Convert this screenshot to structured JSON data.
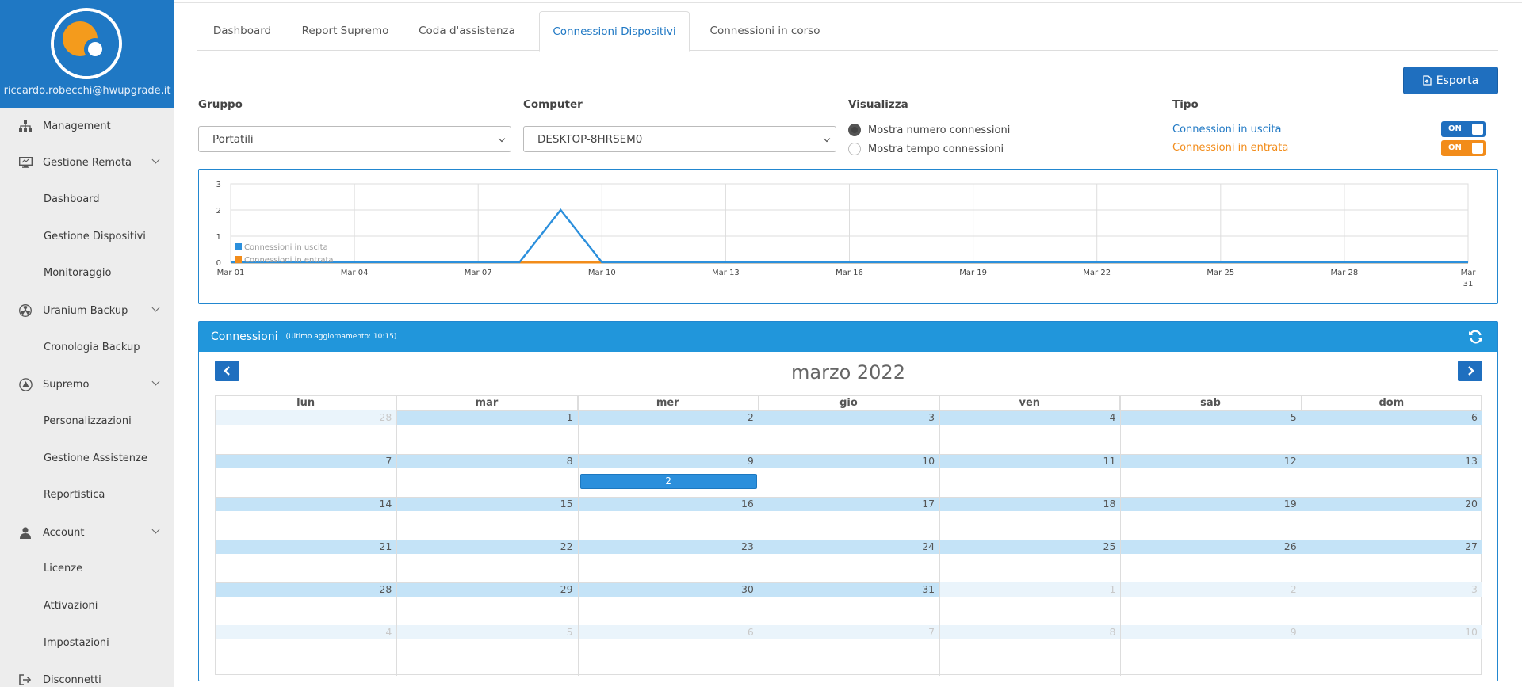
{
  "sidebar": {
    "email": "riccardo.robecchi@hwupgrade.it",
    "items": [
      {
        "label": "Management",
        "icon": "sitemap-icon"
      },
      {
        "label": "Gestione Remota",
        "icon": "desktop-icon"
      },
      {
        "label": "Dashboard"
      },
      {
        "label": "Gestione Dispositivi"
      },
      {
        "label": "Monitoraggio"
      },
      {
        "label": "Uranium Backup",
        "icon": "radiation-icon"
      },
      {
        "label": "Cronologia Backup"
      },
      {
        "label": "Supremo",
        "icon": "supremo-icon"
      },
      {
        "label": "Personalizzazioni"
      },
      {
        "label": "Gestione Assistenze"
      },
      {
        "label": "Reportistica"
      },
      {
        "label": "Account",
        "icon": "user-icon"
      },
      {
        "label": "Licenze"
      },
      {
        "label": "Attivazioni"
      },
      {
        "label": "Impostazioni"
      },
      {
        "label": "Disconnetti",
        "icon": "sign-out-icon"
      }
    ]
  },
  "tabs": [
    "Dashboard",
    "Report Supremo",
    "Coda d'assistenza",
    "Connessioni Dispositivi",
    "Connessioni in corso"
  ],
  "active_tab": "Connessioni Dispositivi",
  "toolbar": {
    "export_label": "Esporta"
  },
  "filters": {
    "gruppo_label": "Gruppo",
    "gruppo_value": "Portatili",
    "computer_label": "Computer",
    "computer_value": "DESKTOP-8HRSEM0",
    "visualizza_label": "Visualizza",
    "radio_count": "Mostra numero connessioni",
    "radio_time": "Mostra tempo connessioni",
    "tipo_label": "Tipo",
    "tipo_out": "Connessioni in uscita",
    "tipo_in": "Connessioni in entrata",
    "toggle_on": "ON"
  },
  "colors": {
    "accent": "#1f78c4",
    "outgoing": "#2b8fdc",
    "incoming": "#f28c1a",
    "day_band": "#c4e3f7"
  },
  "chart_data": {
    "type": "line",
    "x": [
      "Mar 01",
      "Mar 02",
      "Mar 03",
      "Mar 04",
      "Mar 05",
      "Mar 06",
      "Mar 07",
      "Mar 08",
      "Mar 09",
      "Mar 10",
      "Mar 11",
      "Mar 12",
      "Mar 13",
      "Mar 14",
      "Mar 15",
      "Mar 16",
      "Mar 17",
      "Mar 18",
      "Mar 19",
      "Mar 20",
      "Mar 21",
      "Mar 22",
      "Mar 23",
      "Mar 24",
      "Mar 25",
      "Mar 26",
      "Mar 27",
      "Mar 28",
      "Mar 29",
      "Mar 30",
      "Mar 31"
    ],
    "tick_labels": [
      "Mar 01",
      "Mar 04",
      "Mar 07",
      "Mar 10",
      "Mar 13",
      "Mar 16",
      "Mar 19",
      "Mar 22",
      "Mar 25",
      "Mar 28",
      "Mar 31"
    ],
    "series": [
      {
        "name": "Connessioni in uscita",
        "color": "#2b8fdc",
        "values": [
          0,
          0,
          0,
          0,
          0,
          0,
          0,
          0,
          2,
          0,
          0,
          0,
          0,
          0,
          0,
          0,
          0,
          0,
          0,
          0,
          0,
          0,
          0,
          0,
          0,
          0,
          0,
          0,
          0,
          0,
          0
        ]
      },
      {
        "name": "Connessioni in entrata",
        "color": "#f28c1a",
        "values": [
          0,
          0,
          0,
          0,
          0,
          0,
          0,
          0,
          0,
          0,
          0,
          0,
          0,
          0,
          0,
          0,
          0,
          0,
          0,
          0,
          0,
          0,
          0,
          0,
          0,
          0,
          0,
          0,
          0,
          0,
          0
        ]
      }
    ],
    "ylim": [
      0,
      3
    ],
    "yticks": [
      0,
      1,
      2,
      3
    ],
    "legend": "bottom-left",
    "grid": true
  },
  "calendar": {
    "panel_title": "Connessioni",
    "panel_subtitle": "(Ultimo aggiornamento: 10:15)",
    "month_title": "marzo 2022",
    "weekdays": [
      "lun",
      "mar",
      "mer",
      "gio",
      "ven",
      "sab",
      "dom"
    ],
    "weeks": [
      [
        {
          "d": "28",
          "o": true
        },
        {
          "d": "1"
        },
        {
          "d": "2"
        },
        {
          "d": "3"
        },
        {
          "d": "4"
        },
        {
          "d": "5"
        },
        {
          "d": "6"
        }
      ],
      [
        {
          "d": "7"
        },
        {
          "d": "8"
        },
        {
          "d": "9"
        },
        {
          "d": "10"
        },
        {
          "d": "11"
        },
        {
          "d": "12"
        },
        {
          "d": "13"
        }
      ],
      [
        {
          "d": "14"
        },
        {
          "d": "15"
        },
        {
          "d": "16"
        },
        {
          "d": "17"
        },
        {
          "d": "18"
        },
        {
          "d": "19"
        },
        {
          "d": "20"
        }
      ],
      [
        {
          "d": "21"
        },
        {
          "d": "22"
        },
        {
          "d": "23"
        },
        {
          "d": "24"
        },
        {
          "d": "25"
        },
        {
          "d": "26"
        },
        {
          "d": "27"
        }
      ],
      [
        {
          "d": "28"
        },
        {
          "d": "29"
        },
        {
          "d": "30"
        },
        {
          "d": "31"
        },
        {
          "d": "1",
          "o": true
        },
        {
          "d": "2",
          "o": true
        },
        {
          "d": "3",
          "o": true
        }
      ],
      [
        {
          "d": "4",
          "o": true
        },
        {
          "d": "5",
          "o": true
        },
        {
          "d": "6",
          "o": true
        },
        {
          "d": "7",
          "o": true
        },
        {
          "d": "8",
          "o": true
        },
        {
          "d": "9",
          "o": true
        },
        {
          "d": "10",
          "o": true
        }
      ]
    ],
    "events": [
      {
        "date": "9 marzo",
        "label": "2"
      }
    ]
  }
}
